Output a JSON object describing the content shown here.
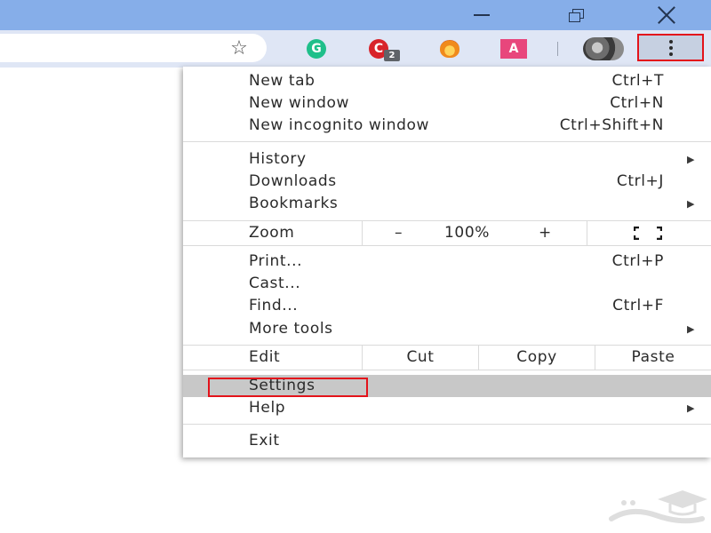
{
  "window": {
    "controls": [
      "minimize",
      "maximize",
      "close"
    ],
    "titlebar_color": "#86aee9"
  },
  "toolbar": {
    "bookmark_icon": "star-icon",
    "extensions": [
      {
        "name": "grammarly",
        "glyph": "G",
        "color": "#1fbf8a"
      },
      {
        "name": "adblock",
        "glyph": "C",
        "color": "#d8232a",
        "badge": "2"
      },
      {
        "name": "fox-extension",
        "color": "#f08a1c"
      },
      {
        "name": "a-extension",
        "glyph": "A",
        "color": "#e8467c"
      }
    ],
    "menu_button_icon": "vertical-dots-icon",
    "highlight_color": "#e3131b"
  },
  "menu": {
    "new_tab": {
      "label": "New tab",
      "shortcut": "Ctrl+T"
    },
    "new_window": {
      "label": "New window",
      "shortcut": "Ctrl+N"
    },
    "new_incognito": {
      "label": "New incognito window",
      "shortcut": "Ctrl+Shift+N"
    },
    "history": {
      "label": "History"
    },
    "downloads": {
      "label": "Downloads",
      "shortcut": "Ctrl+J"
    },
    "bookmarks": {
      "label": "Bookmarks"
    },
    "zoom": {
      "label": "Zoom",
      "minus": "–",
      "level": "100%",
      "plus": "+"
    },
    "print": {
      "label": "Print...",
      "shortcut": "Ctrl+P"
    },
    "cast": {
      "label": "Cast..."
    },
    "find": {
      "label": "Find...",
      "shortcut": "Ctrl+F"
    },
    "more_tools": {
      "label": "More tools"
    },
    "edit": {
      "label": "Edit",
      "cut": "Cut",
      "copy": "Copy",
      "paste": "Paste"
    },
    "settings": {
      "label": "Settings"
    },
    "help": {
      "label": "Help"
    },
    "exit": {
      "label": "Exit"
    },
    "submenu_arrow": "▶"
  }
}
